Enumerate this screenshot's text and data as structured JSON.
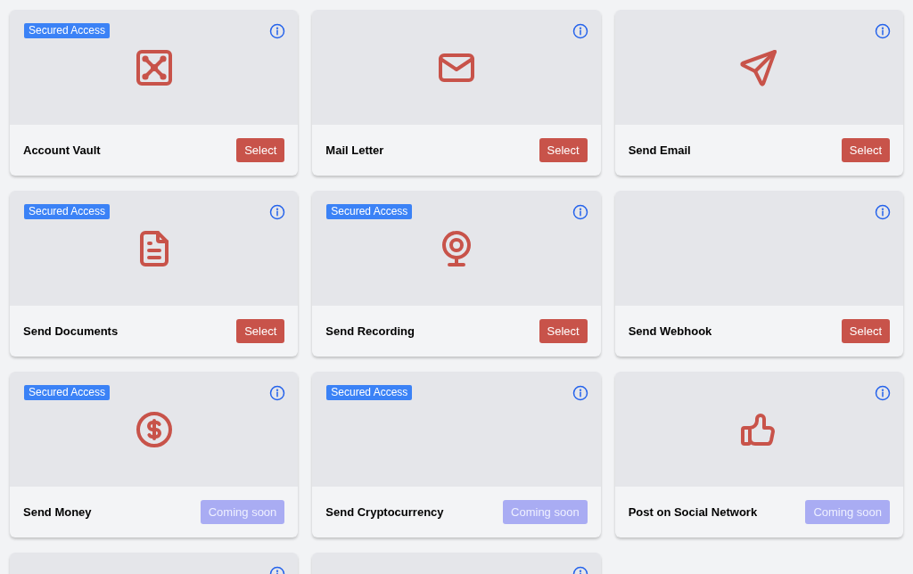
{
  "cards": [
    {
      "badge": "Secured Access",
      "info_icon": true,
      "title": "Account Vault",
      "button": {
        "label": "Select",
        "disabled": false
      }
    },
    {
      "info_icon": true,
      "title": "Mail Letter",
      "button": {
        "label": "Select",
        "disabled": false
      }
    },
    {
      "info_icon": true,
      "title": "Send Email",
      "button": {
        "label": "Select",
        "disabled": false
      }
    },
    {
      "badge": "Secured Access",
      "info_icon": true,
      "title": "Send Documents",
      "button": {
        "label": "Select",
        "disabled": false
      }
    },
    {
      "badge": "Secured Access",
      "info_icon": true,
      "title": "Send Recording",
      "button": {
        "label": "Select",
        "disabled": false
      }
    },
    {
      "info_icon": true,
      "title": "Send Webhook",
      "button": {
        "label": "Select",
        "disabled": false
      }
    },
    {
      "badge": "Secured Access",
      "info_icon": true,
      "title": "Send Money",
      "button": {
        "label": "Coming soon",
        "disabled": true
      }
    },
    {
      "badge": "Secured Access",
      "info_icon": true,
      "title": "Send Cryptocurrency",
      "button": {
        "label": "Coming soon",
        "disabled": true
      }
    },
    {
      "info_icon": true,
      "title": "Post on Social Network",
      "button": {
        "label": "Coming soon",
        "disabled": true
      }
    },
    {
      "info_icon": true
    },
    {
      "info_icon": true
    }
  ]
}
